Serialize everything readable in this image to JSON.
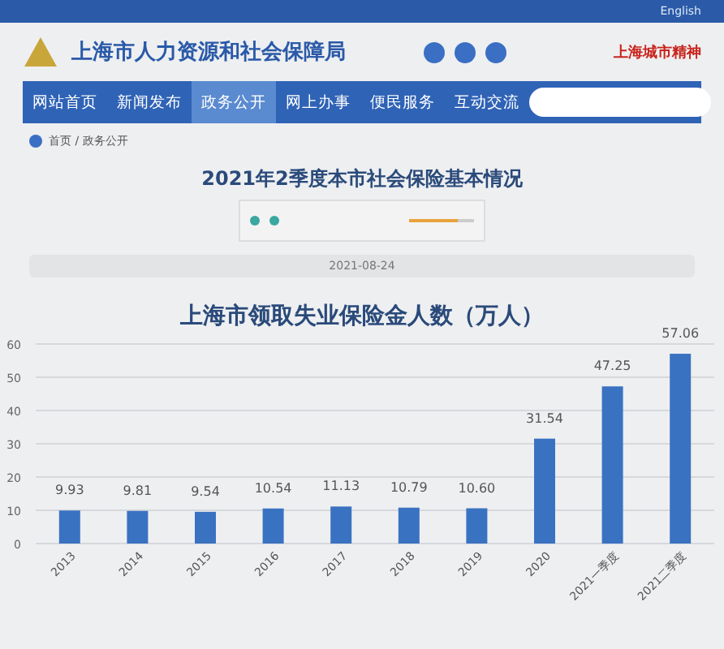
{
  "top_bar": {
    "links": [
      "English"
    ]
  },
  "header": {
    "site_title": "上海市人力资源和社会保障局",
    "slogan": "上海城市精神"
  },
  "nav": {
    "items": [
      {
        "label": "网站首页",
        "selected": false
      },
      {
        "label": "新闻发布",
        "selected": false
      },
      {
        "label": "政务公开",
        "selected": true
      },
      {
        "label": "网上办事",
        "selected": false
      },
      {
        "label": "便民服务",
        "selected": false
      },
      {
        "label": "互动交流",
        "selected": false
      }
    ]
  },
  "breadcrumb": "首页 / 政务公开",
  "article": {
    "title": "2021年2季度本市社会保险基本情况",
    "player": {
      "level": 0.75
    },
    "date": "2021-08-24"
  },
  "chart": {
    "chart_data": {
      "type": "bar",
      "title": "上海市领取失业保险金人数（万人）",
      "categories": [
        "2013",
        "2014",
        "2015",
        "2016",
        "2017",
        "2018",
        "2019",
        "2020",
        "2021一季度",
        "2021二季度"
      ],
      "grid": true,
      "series": [
        {
          "color": "#3a72c2",
          "values": [
            9.93,
            9.81,
            9.54,
            10.54,
            11.13,
            10.79,
            10.6,
            31.54,
            47.25,
            57.06
          ]
        }
      ],
      "value_labels": [
        "9.93",
        "9.81",
        "9.54",
        "10.54",
        "11.13",
        "10.79",
        "10.60",
        "31.54",
        "47.25",
        "57.06"
      ],
      "ylim": [
        0,
        60
      ],
      "yticks": [
        0,
        10,
        20,
        30,
        40,
        50,
        60
      ]
    }
  }
}
